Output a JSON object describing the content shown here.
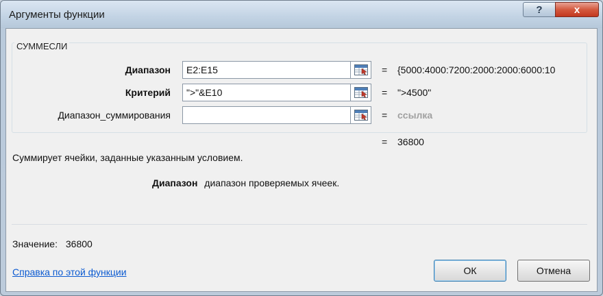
{
  "window": {
    "title": "Аргументы функции",
    "help_label": "?",
    "close_label": "x"
  },
  "function": {
    "name": "СУММЕСЛИ",
    "arguments": [
      {
        "label": "Диапазон",
        "value": "E2:E15",
        "result": "{5000:4000:7200:2000:2000:6000:10",
        "bold": true
      },
      {
        "label": "Критерий",
        "value": "\">\"&E10",
        "result": "\">4500\"",
        "bold": true
      },
      {
        "label": "Диапазон_суммирования",
        "value": "",
        "result": "ссылка",
        "bold": false
      }
    ],
    "equals_sign": "=",
    "result": "36800",
    "description": "Суммирует ячейки, заданные указанным условием.",
    "arg_help_name": "Диапазон",
    "arg_help_text": "диапазон проверяемых ячеек."
  },
  "footer": {
    "value_label": "Значение:",
    "value": "36800",
    "help_link": "Справка по этой функции",
    "ok_label": "ОК",
    "cancel_label": "Отмена"
  },
  "icons": {
    "ref_button": "collapse-dialog-icon"
  }
}
